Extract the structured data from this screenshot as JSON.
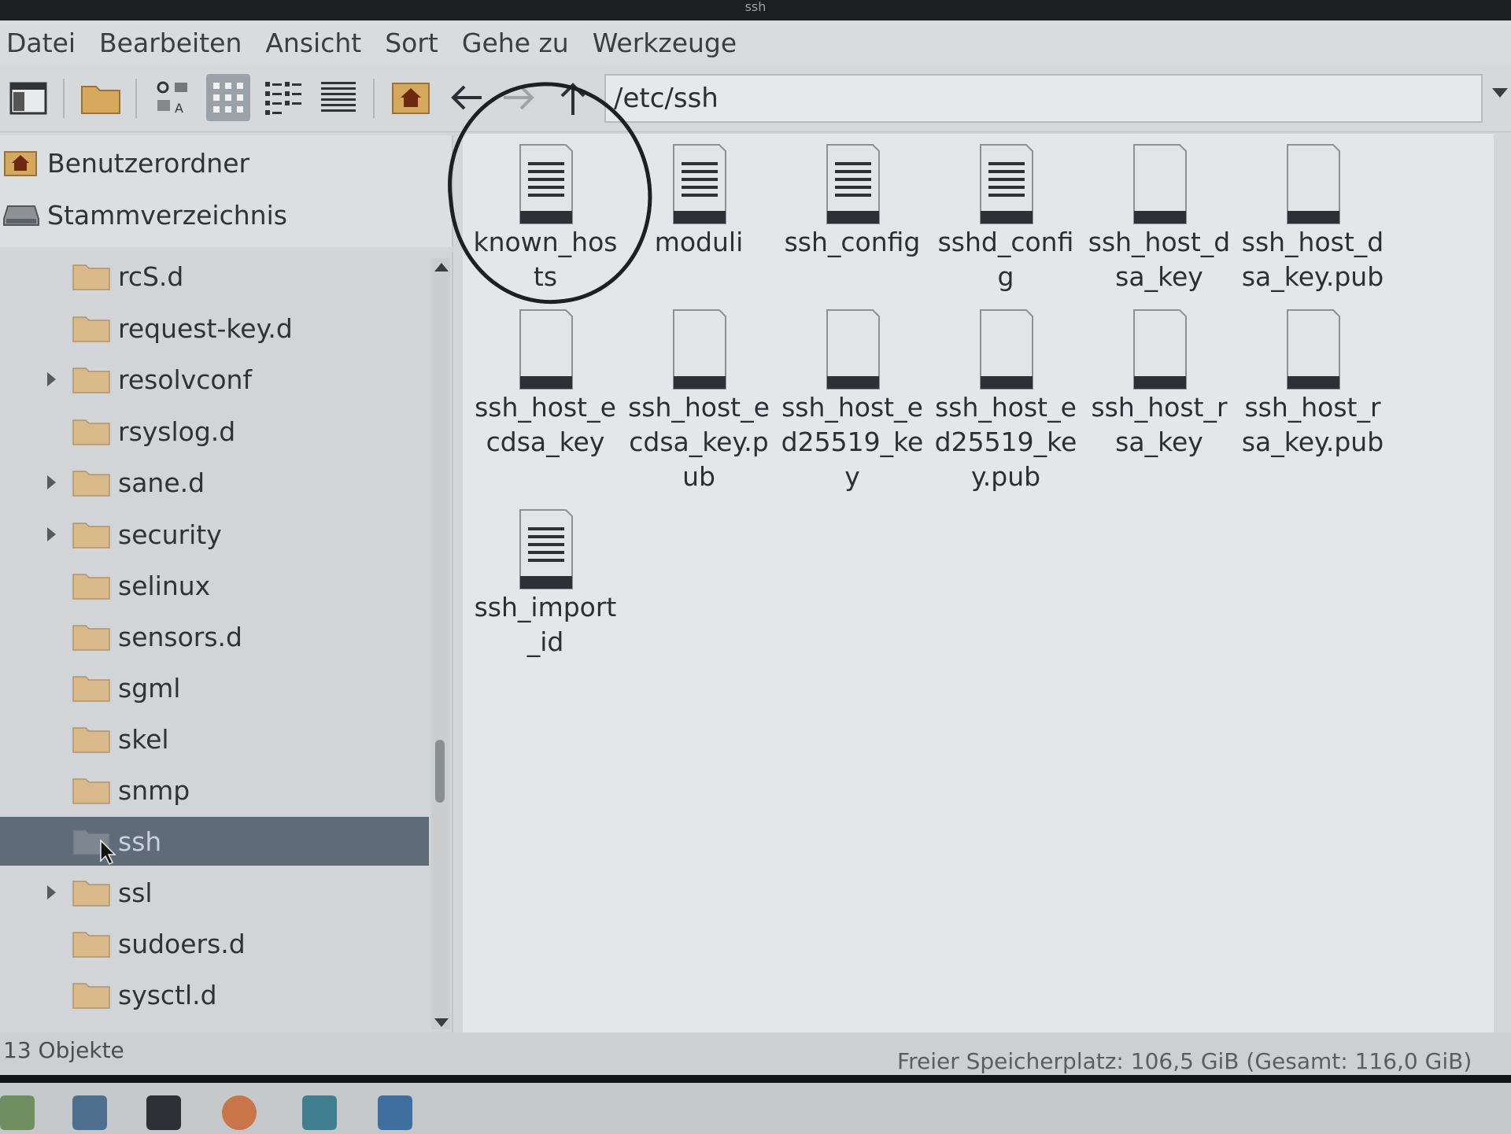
{
  "window": {
    "title": "ssh"
  },
  "menu": [
    "Datei",
    "Bearbeiten",
    "Ansicht",
    "Sort",
    "Gehe zu",
    "Werkzeuge"
  ],
  "toolbar": {
    "icons": [
      "new-window-icon",
      "new-folder-icon",
      "icon-view-icon",
      "thumbnail-view-icon",
      "compact-view-icon",
      "detailed-list-icon",
      "home-icon",
      "back-arrow-icon",
      "forward-arrow-icon",
      "up-arrow-icon"
    ],
    "address": "/etc/ssh"
  },
  "places": [
    {
      "label": "Benutzerordner",
      "icon": "home-icon"
    },
    {
      "label": "Stammverzeichnis",
      "icon": "drive-icon"
    }
  ],
  "tree": [
    {
      "label": "rcS.d",
      "expandable": false,
      "selected": false
    },
    {
      "label": "request-key.d",
      "expandable": false,
      "selected": false
    },
    {
      "label": "resolvconf",
      "expandable": true,
      "selected": false
    },
    {
      "label": "rsyslog.d",
      "expandable": false,
      "selected": false
    },
    {
      "label": "sane.d",
      "expandable": true,
      "selected": false
    },
    {
      "label": "security",
      "expandable": true,
      "selected": false
    },
    {
      "label": "selinux",
      "expandable": false,
      "selected": false
    },
    {
      "label": "sensors.d",
      "expandable": false,
      "selected": false
    },
    {
      "label": "sgml",
      "expandable": false,
      "selected": false
    },
    {
      "label": "skel",
      "expandable": false,
      "selected": false
    },
    {
      "label": "snmp",
      "expandable": false,
      "selected": false
    },
    {
      "label": "ssh",
      "expandable": false,
      "selected": true
    },
    {
      "label": "ssl",
      "expandable": true,
      "selected": false
    },
    {
      "label": "sudoers.d",
      "expandable": false,
      "selected": false
    },
    {
      "label": "sysctl.d",
      "expandable": false,
      "selected": false
    }
  ],
  "files": [
    {
      "name": "known_hosts",
      "kind": "text"
    },
    {
      "name": "moduli",
      "kind": "text"
    },
    {
      "name": "ssh_config",
      "kind": "text"
    },
    {
      "name": "sshd_config",
      "kind": "text"
    },
    {
      "name": "ssh_host_dsa_key",
      "kind": "binary"
    },
    {
      "name": "ssh_host_dsa_key.pub",
      "kind": "binary"
    },
    {
      "name": "ssh_host_ecdsa_key",
      "kind": "binary"
    },
    {
      "name": "ssh_host_ecdsa_key.pub",
      "kind": "binary"
    },
    {
      "name": "ssh_host_ed25519_key",
      "kind": "binary"
    },
    {
      "name": "ssh_host_ed25519_key.pub",
      "kind": "binary"
    },
    {
      "name": "ssh_host_rsa_key",
      "kind": "binary"
    },
    {
      "name": "ssh_host_rsa_key.pub",
      "kind": "binary"
    },
    {
      "name": "ssh_import_id",
      "kind": "text"
    }
  ],
  "status": {
    "left": "13 Objekte",
    "right": "Freier Speicherplatz: 106,5 GiB (Gesamt: 116,0 GiB)"
  },
  "colors": {
    "selection": "#5f6b78",
    "folder": "#d9b98a",
    "annotation": "#1d1f22"
  }
}
